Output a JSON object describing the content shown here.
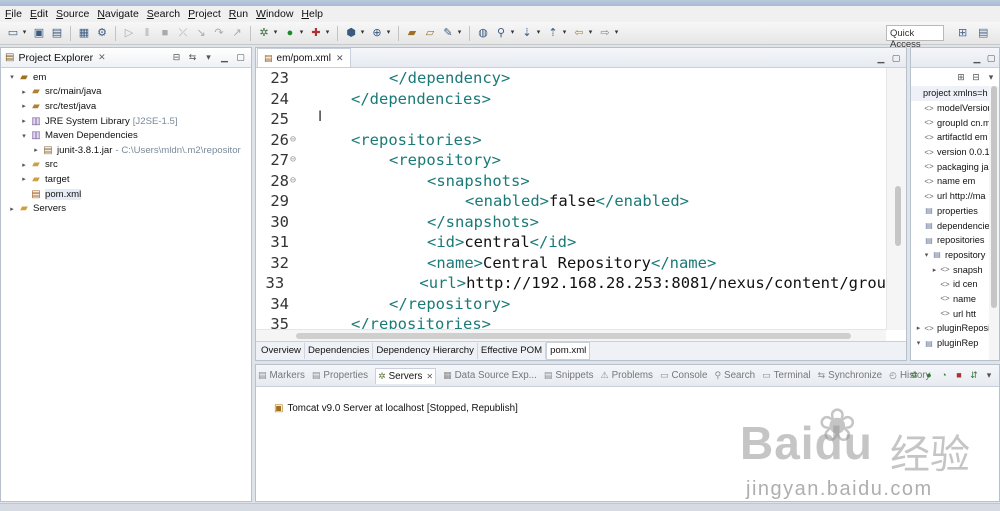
{
  "menu": [
    {
      "label": "File"
    },
    {
      "label": "Edit"
    },
    {
      "label": "Source"
    },
    {
      "label": "Navigate"
    },
    {
      "label": "Search"
    },
    {
      "label": "Project"
    },
    {
      "label": "Run"
    },
    {
      "label": "Window"
    },
    {
      "label": "Help"
    }
  ],
  "toolbar": {
    "quick_access": "Quick Access"
  },
  "explorer": {
    "title": "Project Explorer",
    "tree": [
      {
        "label": "em",
        "decoration": "",
        "depth": 0,
        "twisty": "▾",
        "icon": "project-icon"
      },
      {
        "label": "src/main/java",
        "decoration": "",
        "depth": 1,
        "twisty": "▸",
        "icon": "source-folder-icon"
      },
      {
        "label": "src/test/java",
        "decoration": "",
        "depth": 1,
        "twisty": "▸",
        "icon": "source-folder-icon"
      },
      {
        "label": "JRE System Library",
        "decoration": "[J2SE-1.5]",
        "depth": 1,
        "twisty": "▸",
        "icon": "library-icon"
      },
      {
        "label": "Maven Dependencies",
        "decoration": "",
        "depth": 1,
        "twisty": "▾",
        "icon": "library-icon"
      },
      {
        "label": "junit-3.8.1.jar",
        "decoration": "- C:\\Users\\mldn\\.m2\\repositor",
        "depth": 2,
        "twisty": "▸",
        "icon": "jar-icon"
      },
      {
        "label": "src",
        "decoration": "",
        "depth": 1,
        "twisty": "▸",
        "icon": "folder-icon"
      },
      {
        "label": "target",
        "decoration": "",
        "depth": 1,
        "twisty": "▸",
        "icon": "folder-icon"
      },
      {
        "label": "pom.xml",
        "decoration": "",
        "depth": 1,
        "twisty": "",
        "icon": "xml-file-icon"
      },
      {
        "label": "Servers",
        "decoration": "",
        "depth": 0,
        "twisty": "▸",
        "icon": "folder-icon"
      }
    ]
  },
  "editor": {
    "tab": "em/pom.xml",
    "lines": [
      {
        "num": "23",
        "fold": "",
        "indent": 2,
        "parts": [
          {
            "t": "</dependency>",
            "k": "tag"
          }
        ]
      },
      {
        "num": "24",
        "fold": "",
        "indent": 1,
        "parts": [
          {
            "t": "</dependencies>",
            "k": "tag"
          }
        ]
      },
      {
        "num": "25",
        "fold": "",
        "indent": 0,
        "parts": []
      },
      {
        "num": "26",
        "fold": "⊖",
        "indent": 1,
        "parts": [
          {
            "t": "<repositories>",
            "k": "tag"
          }
        ]
      },
      {
        "num": "27",
        "fold": "⊖",
        "indent": 2,
        "parts": [
          {
            "t": "<repository>",
            "k": "tag"
          }
        ]
      },
      {
        "num": "28",
        "fold": "⊖",
        "indent": 3,
        "parts": [
          {
            "t": "<snapshots>",
            "k": "tag"
          }
        ]
      },
      {
        "num": "29",
        "fold": "",
        "indent": 4,
        "parts": [
          {
            "t": "<enabled>",
            "k": "tag"
          },
          {
            "t": "false",
            "k": "txt"
          },
          {
            "t": "</enabled>",
            "k": "tag"
          }
        ]
      },
      {
        "num": "30",
        "fold": "",
        "indent": 3,
        "parts": [
          {
            "t": "</snapshots>",
            "k": "tag"
          }
        ]
      },
      {
        "num": "31",
        "fold": "",
        "indent": 3,
        "parts": [
          {
            "t": "<id>",
            "k": "tag"
          },
          {
            "t": "central",
            "k": "txt"
          },
          {
            "t": "</id>",
            "k": "tag"
          }
        ]
      },
      {
        "num": "32",
        "fold": "",
        "indent": 3,
        "parts": [
          {
            "t": "<name>",
            "k": "tag"
          },
          {
            "t": "Central Repository",
            "k": "txt"
          },
          {
            "t": "</name>",
            "k": "tag"
          }
        ]
      },
      {
        "num": "33",
        "fold": "",
        "indent": 3,
        "parts": [
          {
            "t": "<url>",
            "k": "tag"
          },
          {
            "t": "http://192.168.28.253:8081/nexus/content/grou",
            "k": "txt"
          }
        ]
      },
      {
        "num": "34",
        "fold": "",
        "indent": 2,
        "parts": [
          {
            "t": "</repository>",
            "k": "tag"
          }
        ]
      },
      {
        "num": "35",
        "fold": "",
        "indent": 1,
        "parts": [
          {
            "t": "</repositories>",
            "k": "tag"
          }
        ]
      }
    ],
    "bottom_tabs": [
      "Overview",
      "Dependencies",
      "Dependency Hierarchy",
      "Effective POM",
      "pom.xml"
    ],
    "active_bottom_tab": "pom.xml"
  },
  "outline": {
    "items": [
      {
        "label": "project xmlns=h",
        "depth": 0,
        "twisty": "",
        "icon": "",
        "selected": true
      },
      {
        "label": "modelVersion",
        "depth": 0,
        "twisty": "",
        "icon": "element-icon"
      },
      {
        "label": "groupId  cn.m",
        "depth": 0,
        "twisty": "",
        "icon": "element-icon"
      },
      {
        "label": "artifactId  em",
        "depth": 0,
        "twisty": "",
        "icon": "element-icon"
      },
      {
        "label": "version  0.0.1",
        "depth": 0,
        "twisty": "",
        "icon": "element-icon"
      },
      {
        "label": "packaging  ja",
        "depth": 0,
        "twisty": "",
        "icon": "element-icon"
      },
      {
        "label": "name  em",
        "depth": 0,
        "twisty": "",
        "icon": "element-icon"
      },
      {
        "label": "url  http://ma",
        "depth": 0,
        "twisty": "",
        "icon": "element-icon"
      },
      {
        "label": "properties",
        "depth": 0,
        "twisty": "",
        "icon": "node-icon"
      },
      {
        "label": "dependencie",
        "depth": 0,
        "twisty": "",
        "icon": "node-icon"
      },
      {
        "label": "repositories",
        "depth": 0,
        "twisty": "",
        "icon": "node-icon"
      },
      {
        "label": "repository",
        "depth": 1,
        "twisty": "▾",
        "icon": "node-icon"
      },
      {
        "label": "snapsh",
        "depth": 2,
        "twisty": "▸",
        "icon": "element-icon"
      },
      {
        "label": "id  cen",
        "depth": 2,
        "twisty": "",
        "icon": "element-icon"
      },
      {
        "label": "name",
        "depth": 2,
        "twisty": "",
        "icon": "element-icon"
      },
      {
        "label": "url  htt",
        "depth": 2,
        "twisty": "",
        "icon": "element-icon"
      },
      {
        "label": "pluginReposi",
        "depth": 0,
        "twisty": "▸",
        "icon": "element-icon"
      },
      {
        "label": "pluginRep",
        "depth": 0,
        "twisty": "▾",
        "icon": "node-icon"
      }
    ]
  },
  "views": {
    "tabs": [
      {
        "label": "Markers",
        "icon": "markers-icon",
        "active": false
      },
      {
        "label": "Properties",
        "icon": "properties-icon",
        "active": false
      },
      {
        "label": "Servers",
        "icon": "servers-icon",
        "active": true
      },
      {
        "label": "Data Source Exp...",
        "icon": "data-source-icon",
        "active": false
      },
      {
        "label": "Snippets",
        "icon": "snippets-icon",
        "active": false
      },
      {
        "label": "Problems",
        "icon": "problems-icon",
        "active": false
      },
      {
        "label": "Console",
        "icon": "console-icon",
        "active": false
      },
      {
        "label": "Search",
        "icon": "search-icon",
        "active": false
      },
      {
        "label": "Terminal",
        "icon": "terminal-icon",
        "active": false
      },
      {
        "label": "Synchronize",
        "icon": "synchronize-icon",
        "active": false
      },
      {
        "label": "History",
        "icon": "history-icon",
        "active": false
      }
    ],
    "server": "Tomcat v9.0 Server at localhost  [Stopped, Republish]"
  },
  "watermark": {
    "brand": "Bai",
    "brand2": "du",
    "brand_cn": "经验",
    "site": "jingyan.baidu.com"
  },
  "colors": {
    "xml_tag": "#1a7a78",
    "text": "#111111",
    "decoration": "#7a8a9a"
  }
}
